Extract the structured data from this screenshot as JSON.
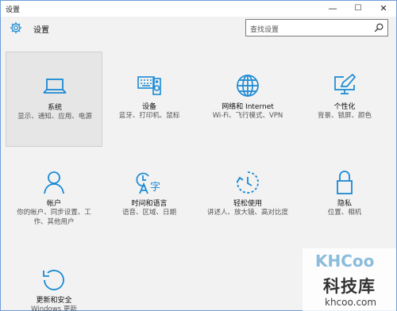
{
  "window": {
    "title": "设置",
    "controls": {
      "minimize": "—",
      "maximize": "☐",
      "close": "✕"
    }
  },
  "header": {
    "heading": "设置",
    "search_placeholder": "查找设置"
  },
  "tiles": [
    {
      "name": "系统",
      "desc": "显示、通知、应用、电源",
      "icon": "laptop-icon"
    },
    {
      "name": "设备",
      "desc": "蓝牙、打印机、鼠标",
      "icon": "keyboard-speaker-icon"
    },
    {
      "name": "网络和 Internet",
      "desc": "Wi-Fi、飞行模式、VPN",
      "icon": "globe-icon"
    },
    {
      "name": "个性化",
      "desc": "背景、锁屏、颜色",
      "icon": "paint-monitor-icon"
    },
    {
      "name": "帐户",
      "desc": "你的帐户、同步设置、工作、其他用户",
      "icon": "person-icon"
    },
    {
      "name": "时间和语言",
      "desc": "语音、区域、日期",
      "icon": "time-language-icon"
    },
    {
      "name": "轻松使用",
      "desc": "讲述人、放大镜、高对比度",
      "icon": "ease-of-access-icon"
    },
    {
      "name": "隐私",
      "desc": "位置、相机",
      "icon": "lock-icon"
    },
    {
      "name": "更新和安全",
      "desc": "Windows 更新",
      "icon": "update-icon"
    }
  ],
  "watermark": {
    "logo": "KHCoo",
    "name": "科技库",
    "url": "khcoo.com"
  },
  "colors": {
    "accent": "#1a8ad4",
    "window_bg": "#f2f2f2",
    "border": "#6f9fd8"
  }
}
